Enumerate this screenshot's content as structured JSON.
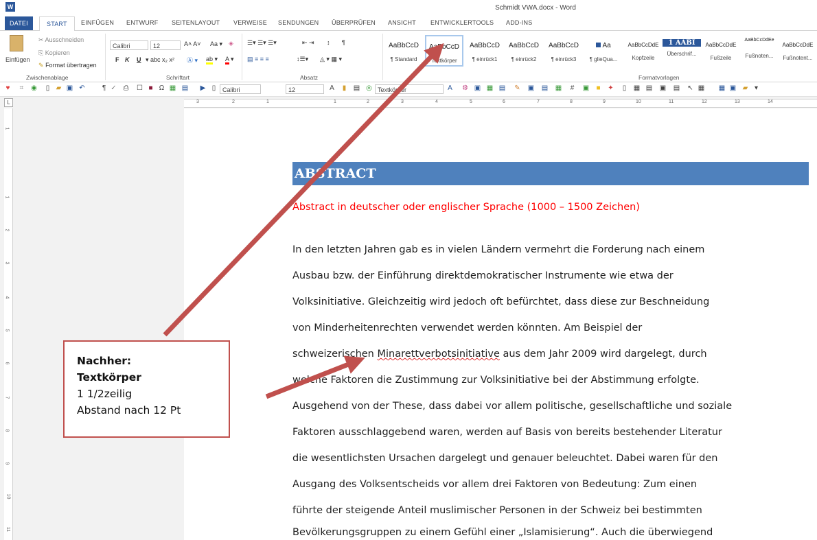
{
  "window": {
    "title": "Schmidt VWA.docx - Word",
    "app_icon": "W"
  },
  "tabs": [
    {
      "label": "DATEI"
    },
    {
      "label": "START"
    },
    {
      "label": "EINFÜGEN"
    },
    {
      "label": "ENTWURF"
    },
    {
      "label": "SEITENLAYOUT"
    },
    {
      "label": "VERWEISE"
    },
    {
      "label": "SENDUNGEN"
    },
    {
      "label": "ÜBERPRÜFEN"
    },
    {
      "label": "ANSICHT"
    },
    {
      "label": "ENTWICKLERTOOLS"
    },
    {
      "label": "ADD-INS"
    }
  ],
  "clipboard": {
    "paste_label": "Einfügen",
    "cut_label": "Ausschneiden",
    "copy_label": "Kopieren",
    "format_label": "Format übertragen",
    "group_label": "Zwischenablage"
  },
  "font": {
    "name": "Calibri",
    "size": "12",
    "group_label": "Schriftart",
    "bold": "F",
    "italic": "K",
    "underline": "U"
  },
  "paragraph": {
    "group_label": "Absatz"
  },
  "styles": {
    "group_label": "Formatvorlagen",
    "items": [
      {
        "sample": "AaBbCcD",
        "name": "¶ Standard"
      },
      {
        "sample": "AaBbCcD",
        "name": "Textkörper"
      },
      {
        "sample": "AaBbCcD",
        "name": "¶ einrück1"
      },
      {
        "sample": "AaBbCcD",
        "name": "¶ einrück2"
      },
      {
        "sample": "AaBbCcD",
        "name": "¶ einrück3"
      },
      {
        "sample": "Aa",
        "name": "¶ glieQua..."
      },
      {
        "sample": "AaBbCcDdE",
        "name": "Kopfzeile"
      },
      {
        "sample": "1 AABI",
        "name": "Überschrif..."
      },
      {
        "sample": "AaBbCcDdE",
        "name": "Fußzeile"
      },
      {
        "sample": "AaBbCcDdEe",
        "name": "Fußnoten..."
      },
      {
        "sample": "AaBbCcDdE",
        "name": "Fußnotent..."
      }
    ]
  },
  "qat": {
    "font": "Calibri",
    "size": "12",
    "style": "Textkörper"
  },
  "ruler": {
    "h_numbers": [
      "3",
      "2",
      "1",
      "1",
      "2",
      "3",
      "4",
      "5",
      "6",
      "7",
      "8",
      "9",
      "10",
      "11",
      "12",
      "13",
      "14"
    ],
    "v_numbers": [
      "1",
      "1",
      "2",
      "3",
      "4",
      "5",
      "6",
      "7",
      "8",
      "9",
      "10",
      "11"
    ]
  },
  "document": {
    "heading": "ABSTRACT",
    "subtitle": "Abstract in deutscher oder englischer Sprache (1000 – 1500 Zeichen)",
    "lines": [
      "In den letzten Jahren gab es in vielen Ländern vermehrt die Forderung nach einem",
      "Ausbau bzw. der Einführung direktdemokratischer Instrumente wie etwa der",
      "Volksinitiative. Gleichzeitig wird jedoch oft befürchtet, dass diese zur Beschneidung",
      "von Minderheitenrechten verwendet werden könnten. Am Beispiel der",
      "schweizerischen ",
      "Minarettverbotsinitiative",
      " aus dem Jahr 2009 wird dargelegt, durch",
      "welche Faktoren die Zustimmung zur Volksinitiative bei der Abstimmung erfolgte.",
      "Ausgehend von der These, dass dabei vor allem politische, gesellschaftliche und soziale",
      "Faktoren ausschlaggebend waren, werden auf Basis von bereits bestehender Literatur",
      "die wesentlichsten Ursachen dargelegt und genauer beleuchtet. Dabei waren für den",
      "Ausgang des Volksentscheids vor allem drei Faktoren von Bedeutung: Zum einen",
      "führte der steigende Anteil muslimischer Personen in der Schweiz bei bestimmten",
      "Bevölkerungsgruppen zu einem Gefühl einer „Islamisierung“. Auch die überwiegend"
    ]
  },
  "callout": {
    "line1": "Nachher:",
    "line2": "Textkörper",
    "line3": "1 1/2zeilig",
    "line4": "Abstand nach 12 Pt",
    "color": "#c0504d"
  }
}
